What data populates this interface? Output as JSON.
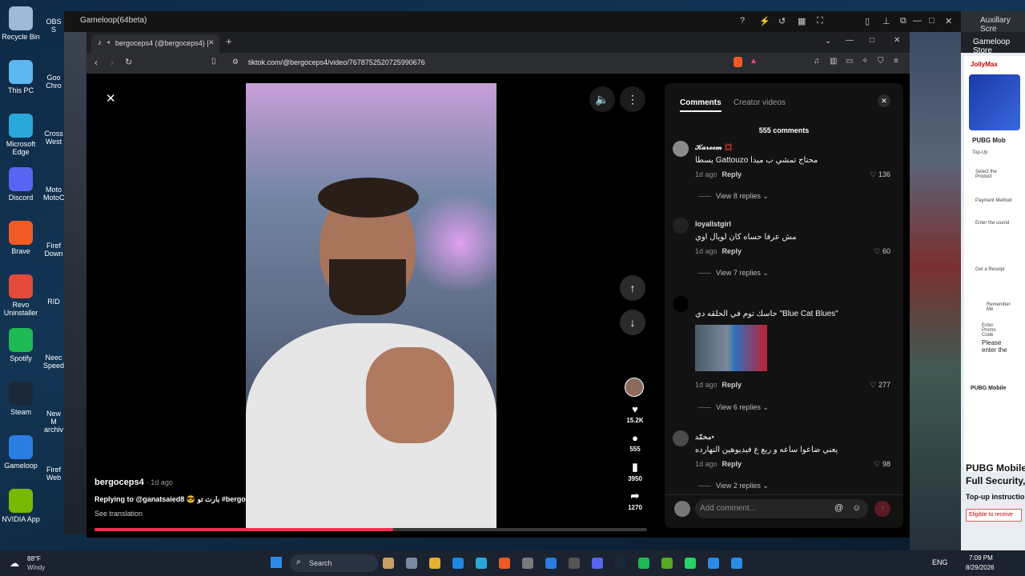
{
  "desktop": {
    "icons": [
      {
        "label": "Recycle Bin",
        "color": "#9fb8d6"
      },
      {
        "label": "This PC",
        "color": "#5db6f0"
      },
      {
        "label": "Microsoft Edge",
        "color": "#2aa8d8"
      },
      {
        "label": "Discord",
        "color": "#5865f2"
      },
      {
        "label": "Brave",
        "color": "#f15a24"
      },
      {
        "label": "Revo Uninstaller",
        "color": "#e24a3a"
      },
      {
        "label": "Spotify",
        "color": "#1db954"
      },
      {
        "label": "Steam",
        "color": "#1b2838"
      },
      {
        "label": "Gameloop",
        "color": "#2a7de1"
      },
      {
        "label": "NVIDIA App",
        "color": "#76b900"
      }
    ],
    "second_column": [
      "OBS S",
      "Goo Chro",
      "Cross West",
      "Moto MotoC",
      "Firef Down",
      "RID",
      "Neec Speed",
      "New M archiv",
      "Firef Web"
    ]
  },
  "gameloop": {
    "title": "Gameloop(64beta)",
    "aux_title": "Auxillary Scre",
    "store_title": "Gameloop Store"
  },
  "browser": {
    "tab_title": "bergoceps4 (@bergoceps4) |",
    "new_tab": "+",
    "url": "tiktok.com/@bergoceps4/video/7678752520725990676"
  },
  "video": {
    "author": "bergoceps4",
    "age": "· 1d ago",
    "caption": "Replying to @ganatsaied8 😎 بارت تو #bergo",
    "see_translation": "See translation",
    "progress_fraction": 0.54,
    "likes": "15.2K",
    "comments": "555",
    "saves": "3950",
    "shares": "1270"
  },
  "comments_panel": {
    "tab_comments": "Comments",
    "tab_creator": "Creator videos",
    "count": "555 comments",
    "input_placeholder": "Add comment...",
    "items": [
      {
        "name": "𝓚𝓪𝓻𝓮𝓮𝓶 💢",
        "text": "يسطا Gattouzo محتاج تمشي ب ميدا",
        "age": "1d ago",
        "reply": "Reply",
        "likes": "136",
        "replies": "View 8 replies"
      },
      {
        "name": "loyallstgirl",
        "text": "مش عرفا حساه كان لويال اوي",
        "age": "1d ago",
        "reply": "Reply",
        "likes": "60",
        "replies": "View 7 replies"
      },
      {
        "name": "",
        "text": "حاسك توم في الحلقه دي \"Blue Cat Blues\"",
        "age": "1d ago",
        "reply": "Reply",
        "likes": "277",
        "replies": "View 6 replies"
      },
      {
        "name": "محمّد•",
        "text": "يعني ضاعوا ساعه و ربع ع فيديوهين النهارده",
        "age": "1d ago",
        "reply": "Reply",
        "likes": "98",
        "replies": "View 2 replies"
      }
    ]
  },
  "right_panel": {
    "items": [
      "JollyMax",
      "PUBG Mob",
      "Top-Up",
      "Select the Product",
      "Payment Method",
      "Enter the userid",
      "Get a Receipt",
      "Remember Me",
      "Enter Promo Code",
      "Please enter the",
      "PUBG Mobile"
    ],
    "big1": "PUBG Mobile",
    "big2": "Full Security,",
    "small1": "Top-up instructio",
    "small2": "Eligible to receive"
  },
  "taskbar": {
    "weather_temp": "88°F",
    "weather_desc": "Windy",
    "search": "Search",
    "lang": "ENG",
    "time": "7:09 PM",
    "date": "8/29/2026"
  }
}
